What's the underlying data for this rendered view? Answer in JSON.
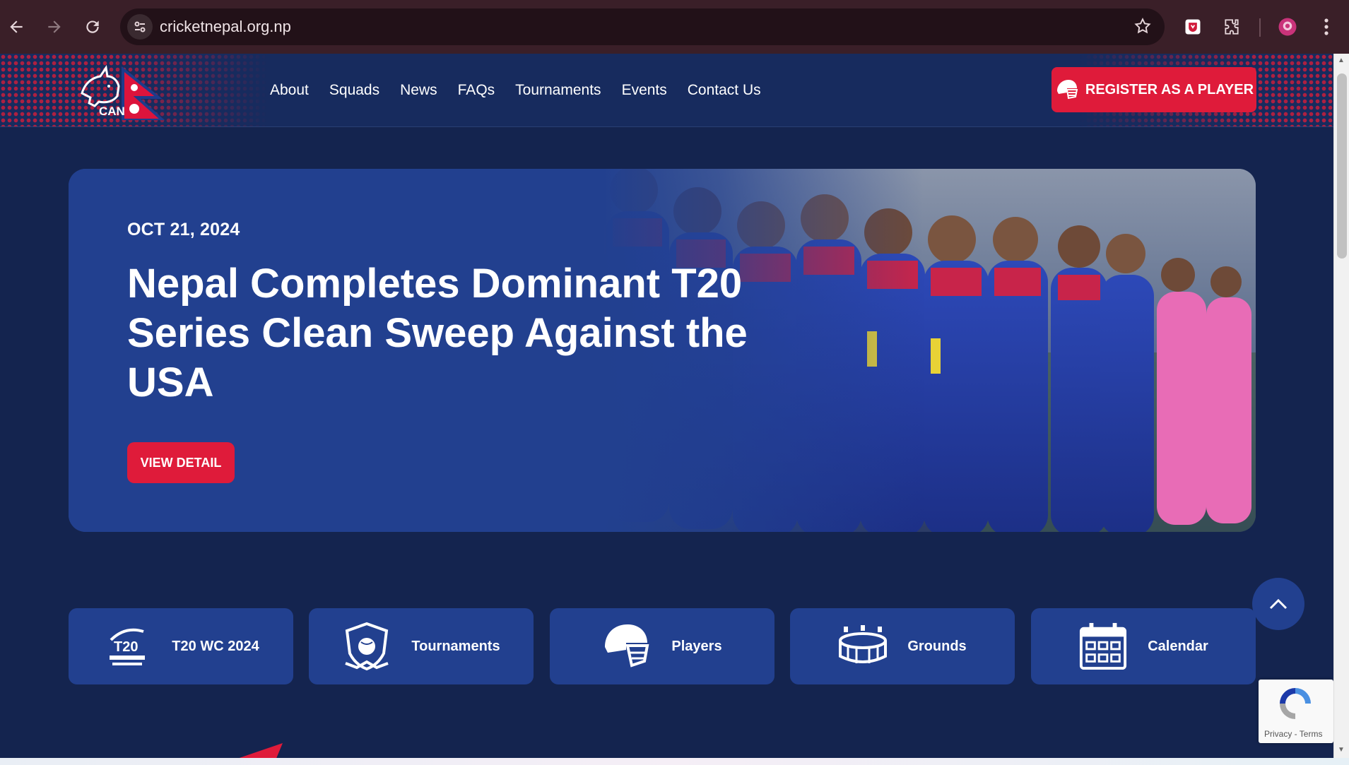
{
  "browser": {
    "url": "cricketnepal.org.np",
    "back_icon": "arrow-left-icon",
    "forward_icon": "arrow-right-icon",
    "reload_icon": "reload-icon"
  },
  "header": {
    "logo_text": "CAN",
    "nav": [
      "About",
      "Squads",
      "News",
      "FAQs",
      "Tournaments",
      "Events",
      "Contact Us"
    ],
    "register_label": "REGISTER AS A PLAYER"
  },
  "hero": {
    "date": "OCT 21, 2024",
    "title": "Nepal Completes Dominant T20 Series Clean Sweep Against the USA",
    "button_label": "VIEW DETAIL"
  },
  "cards": [
    {
      "label": "T20 WC 2024",
      "icon": "t20-world-cup-logo"
    },
    {
      "label": "Tournaments",
      "icon": "shield-ball-icon"
    },
    {
      "label": "Players",
      "icon": "helmet-icon"
    },
    {
      "label": "Grounds",
      "icon": "stadium-icon"
    },
    {
      "label": "Calendar",
      "icon": "calendar-icon"
    }
  ],
  "recaptcha": {
    "links": "Privacy - Terms"
  },
  "colors": {
    "navy": "#14244f",
    "card_blue": "#22408f",
    "accent_red": "#df1b3a"
  }
}
